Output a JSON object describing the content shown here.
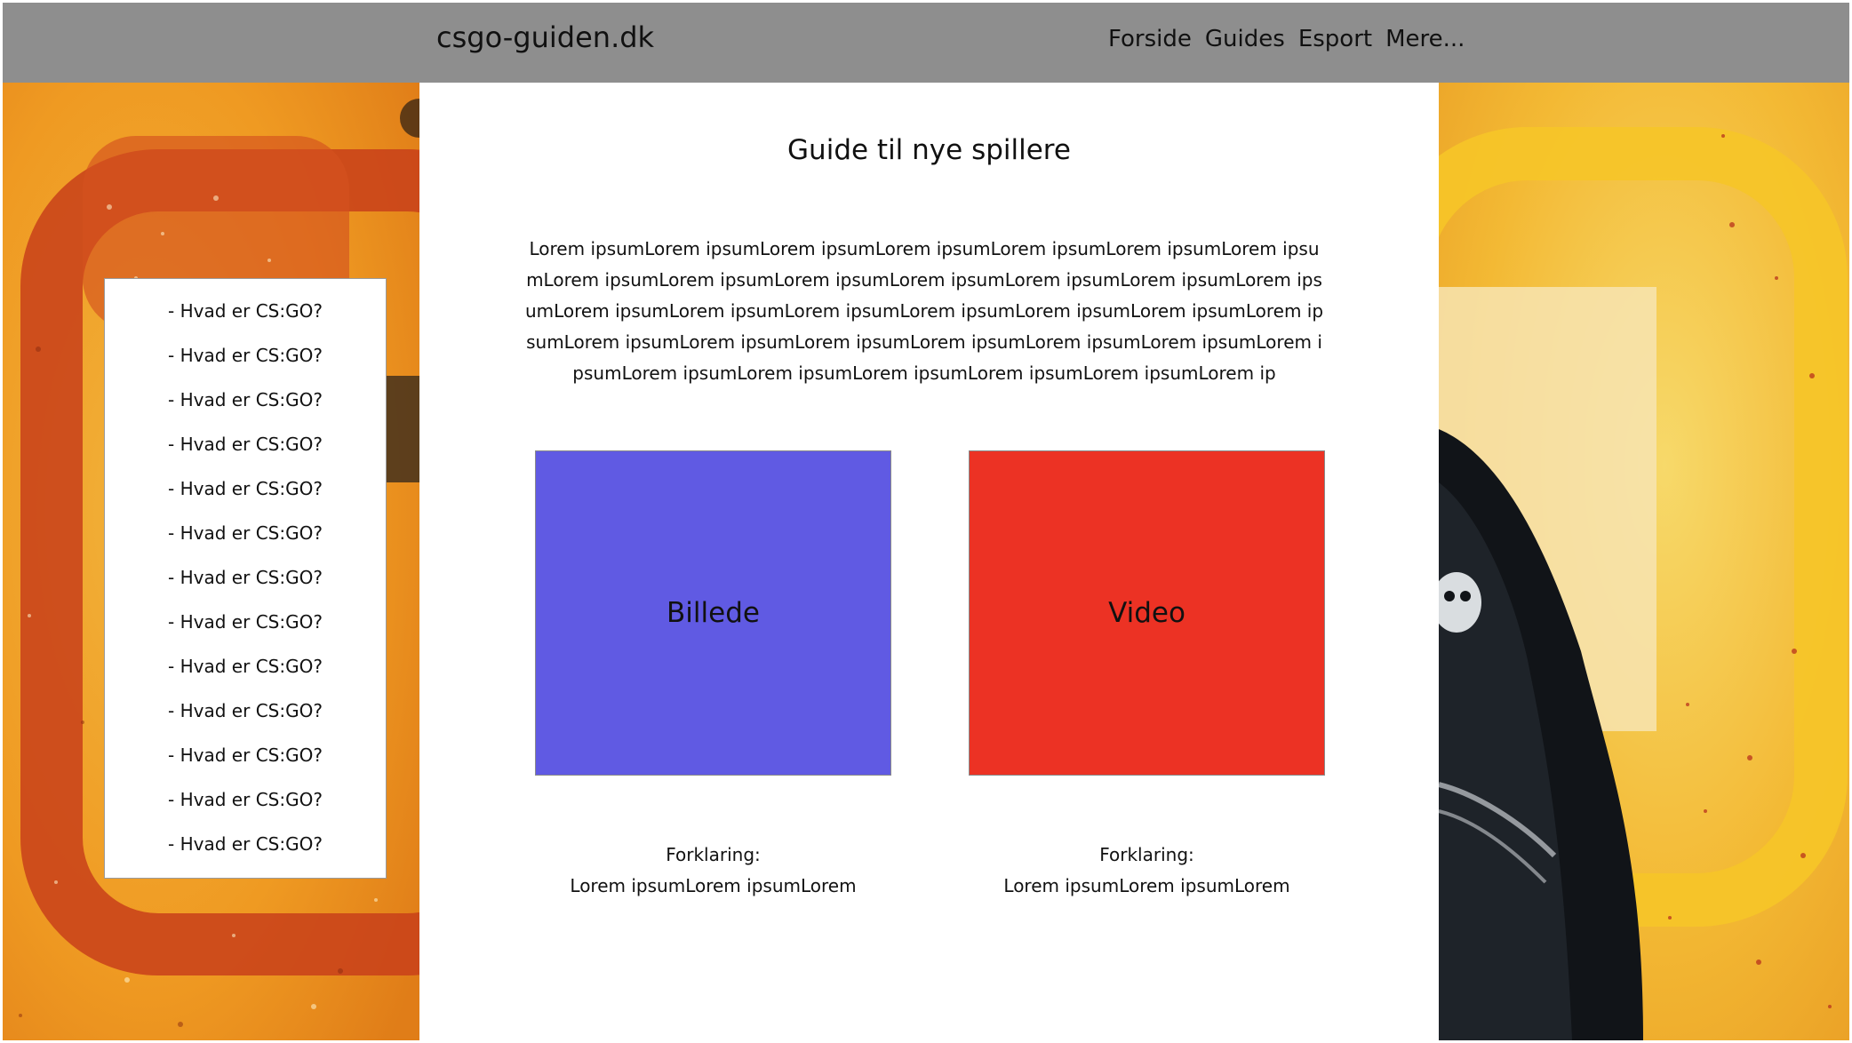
{
  "header": {
    "logo": "csgo-guiden.dk",
    "nav": [
      "Forside",
      "Guides",
      "Esport",
      "Mere..."
    ]
  },
  "sidebar": {
    "items": [
      "- Hvad er CS:GO?",
      "- Hvad er CS:GO?",
      "- Hvad er CS:GO?",
      "- Hvad er CS:GO?",
      "- Hvad er CS:GO?",
      "- Hvad er CS:GO?",
      "- Hvad er CS:GO?",
      "- Hvad er CS:GO?",
      "- Hvad er CS:GO?",
      "- Hvad er CS:GO?",
      "- Hvad er CS:GO?",
      "- Hvad er CS:GO?",
      "- Hvad er CS:GO?"
    ]
  },
  "main": {
    "title": "Guide til nye spillere",
    "intro": "Lorem ipsumLorem ipsumLorem ipsumLorem ipsumLorem ipsumLorem ipsumLorem ipsumLorem ipsumLorem ipsumLorem ipsumLorem ipsumLorem ipsumLorem ipsumLorem ipsumLorem ipsumLorem ipsumLorem ipsumLorem ipsumLorem ipsumLorem ipsumLorem ipsumLorem ipsumLorem ipsumLorem ipsumLorem ipsumLorem ipsumLorem ipsumLorem ipsumLorem ipsumLorem ipsumLorem ipsumLorem ipsumLorem ipsumLorem ip",
    "cards": [
      {
        "label": "Billede",
        "caption_title": "Forklaring:",
        "caption_text": "Lorem ipsumLorem ipsumLorem",
        "color": "#605ae3"
      },
      {
        "label": "Video",
        "caption_title": "Forklaring:",
        "caption_text": "Lorem ipsumLorem ipsumLorem",
        "color": "#ec3224"
      }
    ]
  },
  "colors": {
    "header_bg": "#8e8e8e",
    "art_orange": "#f0a224",
    "art_red": "#c8401a",
    "art_yellow": "#f6c528"
  }
}
